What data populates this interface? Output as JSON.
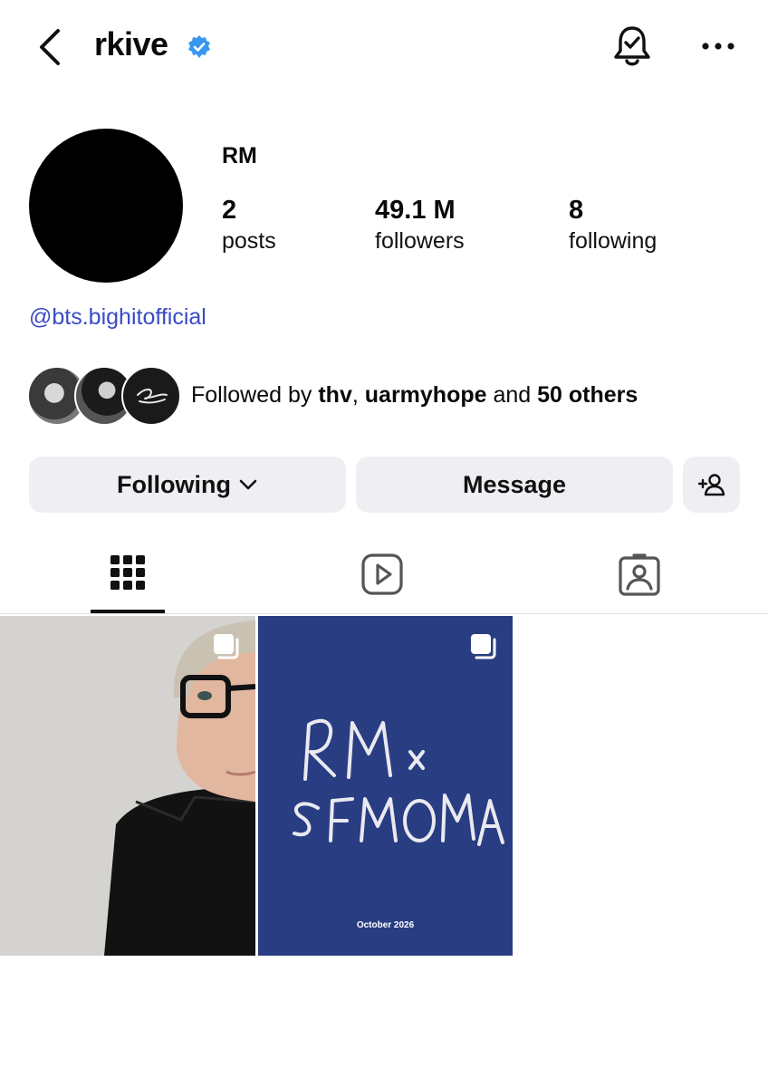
{
  "header": {
    "username": "rkive"
  },
  "profile": {
    "display_name": "RM",
    "stats": [
      {
        "value": "2",
        "label": "posts"
      },
      {
        "value": "49.1 M",
        "label": "followers"
      },
      {
        "value": "8",
        "label": "following"
      }
    ],
    "bio_link": "@bts.bighitofficial"
  },
  "mutuals": {
    "prefix": "Followed by ",
    "user1": "thv",
    "sep": ", ",
    "user2": "uarmyhope",
    "and": " and ",
    "others": "50 others"
  },
  "actions": {
    "following_label": "Following",
    "message_label": "Message"
  },
  "tabs": [
    {
      "icon": "grid-icon",
      "active": true
    },
    {
      "icon": "reels-icon",
      "active": false
    },
    {
      "icon": "tagged-icon",
      "active": false
    }
  ],
  "posts": [
    {
      "type": "photo",
      "multi": true
    },
    {
      "type": "poster",
      "multi": true,
      "poster_date": "October 2026"
    }
  ],
  "colors": {
    "accent_link": "#3a4bc4",
    "verified": "#3897f0",
    "button_bg": "#efeff3",
    "poster_bg": "#293d82"
  }
}
